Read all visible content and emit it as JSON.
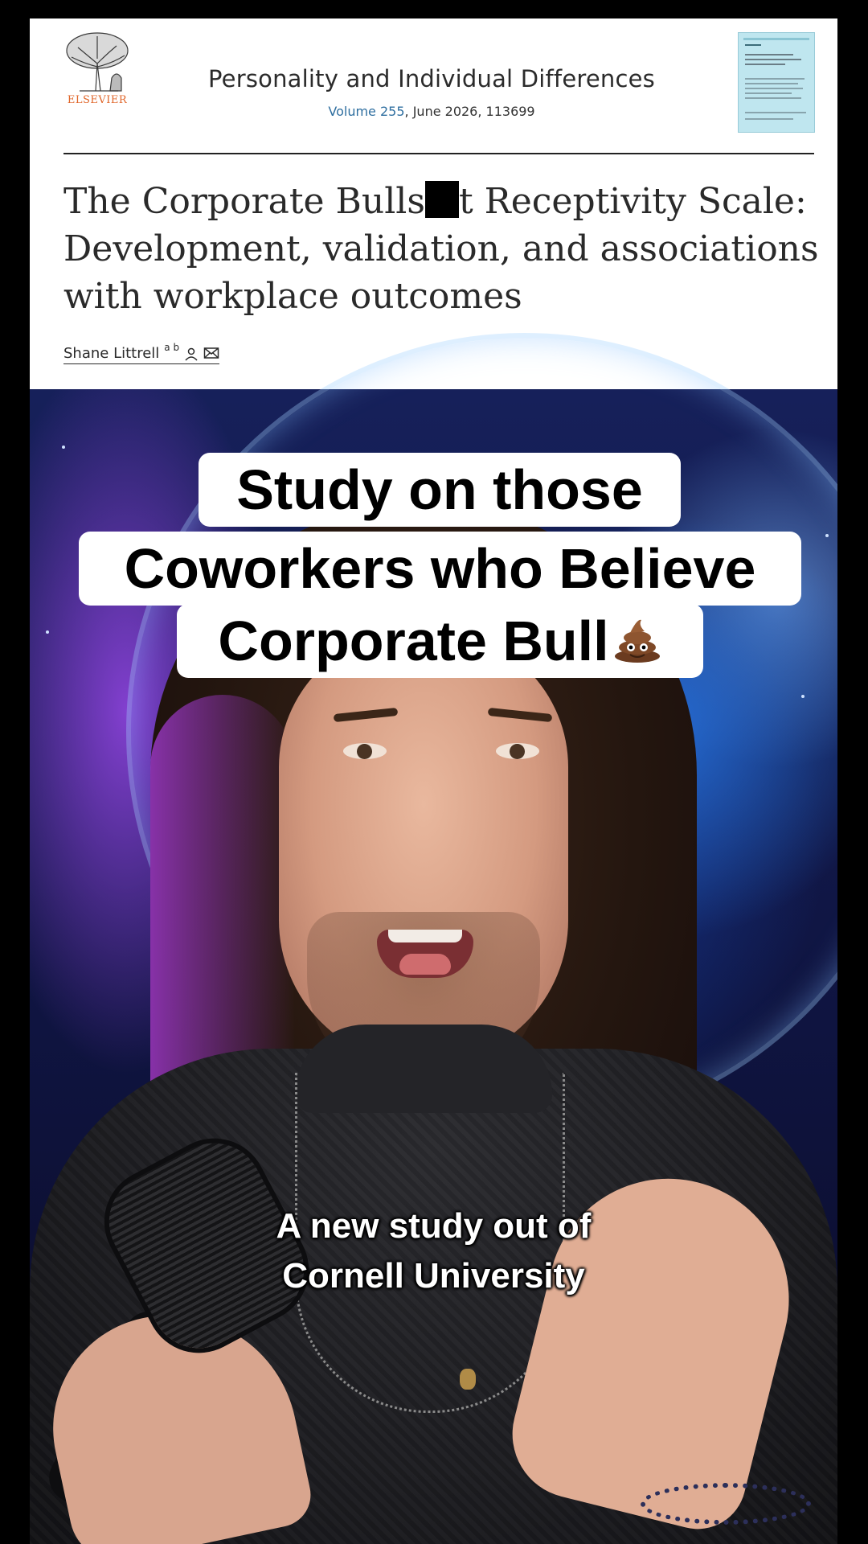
{
  "article": {
    "publisher_logo_text": "ELSEVIER",
    "journal_name": "Personality and Individual Differences",
    "volume_link": "Volume 255",
    "issue_details": ", June 2026, 113699",
    "title_part1": "The Corporate Bulls",
    "title_part2": "t Receptivity Scale: Development, validation, and associations with workplace outcomes",
    "author_name": "Shane Littrell",
    "author_affiliations": "a b",
    "icons": [
      "elsevier-tree-logo",
      "journal-cover-thumbnail",
      "person-icon",
      "envelope-icon"
    ]
  },
  "video": {
    "caption_lines": [
      "Study on those",
      "Coworkers who Believe",
      "Corporate Bull"
    ],
    "caption_emoji": "poop-emoji",
    "subtitle_lines": [
      "A new study out of",
      "Cornell University"
    ]
  },
  "colors": {
    "background": "#000000",
    "publisher_orange": "#e0662a",
    "link_blue": "#2f6fa0",
    "caption_bg": "#ffffff",
    "caption_text": "#000000"
  }
}
